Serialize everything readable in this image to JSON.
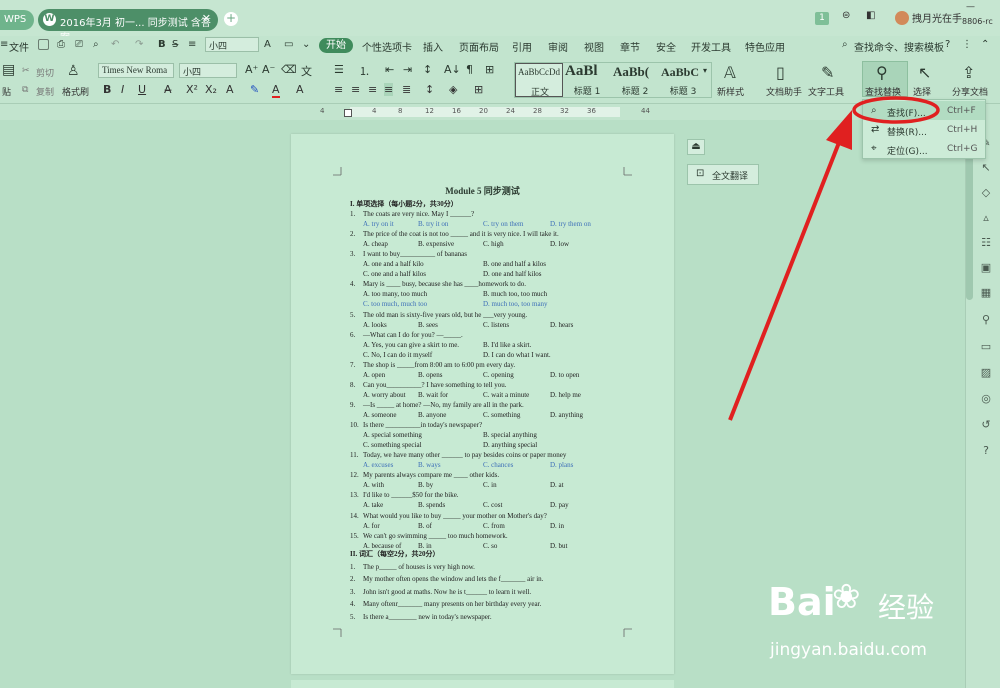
{
  "titlebar": {
    "app_tab": "WPS",
    "doc_tab": "2016年3月 初一...  同步测试 含答案",
    "page_count_badge": "1",
    "user_name": "拽月光在手",
    "user_id": "8806-rc"
  },
  "menubar": {
    "file": "文件",
    "font_size_quick": "小四",
    "items": [
      "开始",
      "个性选项卡",
      "插入",
      "页面布局",
      "引用",
      "审阅",
      "视图",
      "章节",
      "安全",
      "开发工具",
      "特色应用"
    ],
    "search": "查找命令、搜索模板"
  },
  "ribbon": {
    "paste": "贴",
    "cut": "剪切",
    "copy": "复制",
    "format_painter": "格式刷",
    "font_name": "Times New Roma",
    "font_size": "小四",
    "styles": [
      {
        "sample": "AaBbCcDd",
        "name": "正文"
      },
      {
        "sample": "AaBl",
        "name": "标题 1"
      },
      {
        "sample": "AaBb(",
        "name": "标题 2"
      },
      {
        "sample": "AaBbC",
        "name": "标题 3"
      }
    ],
    "new_style": "新样式",
    "doc_helper": "文档助手",
    "text_tools": "文字工具",
    "find_replace": "查找替换",
    "select": "选择",
    "share_doc": "分享文档"
  },
  "ruler": {
    "ticks": [
      "4",
      "4",
      "8",
      "12",
      "16",
      "20",
      "24",
      "28",
      "32",
      "36",
      "44"
    ]
  },
  "floating": {
    "full_translate": "全文翻译"
  },
  "dropdown": {
    "items": [
      {
        "label": "查找(F)...",
        "shortcut": "Ctrl+F"
      },
      {
        "label": "替换(R)...",
        "shortcut": "Ctrl+H"
      },
      {
        "label": "定位(G)...",
        "shortcut": "Ctrl+G"
      }
    ]
  },
  "document": {
    "title": "Module 5 同步测试",
    "section1": "I.  单项选择（每小题2分，共30分）",
    "section2": "II.  词汇（每空2分，共20分）",
    "lines": [
      {
        "n": "1.",
        "t": "The coats are very nice. May I ______?"
      },
      {
        "opts": [
          "A. try on it",
          "B. try it on",
          "C. try on them",
          "D. try them on"
        ],
        "blue": true
      },
      {
        "n": "2.",
        "t": "The price of the coat is not too _____ and it is very nice. I will take it."
      },
      {
        "opts": [
          "A. cheap",
          "B. expensive",
          "C. high",
          "D. low"
        ]
      },
      {
        "n": "3.",
        "t": "I want to buy__________ of bananas"
      },
      {
        "opts2": [
          "A. one and a half kilo",
          "B. one and half a kilos"
        ]
      },
      {
        "opts2": [
          "C. one and a half kilos",
          "D. one and half kilos"
        ]
      },
      {
        "n": "4.",
        "t": "Mary is ____ busy, because she has ____homework to do."
      },
      {
        "opts2": [
          "A. too many, too much",
          "B. much too, too much"
        ]
      },
      {
        "opts2": [
          "C. too much, much too",
          "D. much too, too many"
        ],
        "blue": true
      },
      {
        "n": "5.",
        "t": "The old man is sixty-five years old, but he ___very young."
      },
      {
        "opts": [
          "A. looks",
          "B. sees",
          "C. listens",
          "D. hears"
        ]
      },
      {
        "n": "6.",
        "t": "—What can I do for you? —_____."
      },
      {
        "opts2": [
          "A. Yes, you can give a skirt to me.",
          "B. I'd like a skirt."
        ]
      },
      {
        "opts2": [
          "C. No, I can do it myself",
          "D. I can do what I want."
        ]
      },
      {
        "n": "7.",
        "t": "The shop is _____from 8:00 am to 6:00 pm every day."
      },
      {
        "opts": [
          "A. open",
          "B. opens",
          "C. opening",
          "D. to open"
        ]
      },
      {
        "n": "8.",
        "t": "Can you__________? I have something to tell you."
      },
      {
        "opts": [
          "A. worry about",
          "B. wait for",
          "C. wait a minute",
          "D. help me"
        ]
      },
      {
        "n": "9.",
        "t": "—Is _____ at home?   —No, my family are all in the park."
      },
      {
        "opts": [
          "A. someone",
          "B. anyone",
          "C. something",
          "D. anything"
        ]
      },
      {
        "n": "10.",
        "t": "Is there __________in today's newspaper?"
      },
      {
        "opts2": [
          "A. special something",
          "B. special anything"
        ]
      },
      {
        "opts2": [
          "C. something special",
          "D. anything special"
        ]
      },
      {
        "n": "11.",
        "t": "Today, we have many other ______ to pay besides coins or paper money"
      },
      {
        "opts": [
          "A. excuses",
          "B. ways",
          "C. chances",
          "D. plans"
        ],
        "blue": true
      },
      {
        "n": "12.",
        "t": "My parents always compare me ____ other kids."
      },
      {
        "opts": [
          "A. with",
          "B. by",
          "C. in",
          "D. at"
        ]
      },
      {
        "n": "13.",
        "t": "I'd like to ______$50 for the bike."
      },
      {
        "opts": [
          "A. take",
          "B. spends",
          "C. cost",
          "D. pay"
        ]
      },
      {
        "n": "14.",
        "t": "What would you like to buy _____ your mother on Mother's day?"
      },
      {
        "opts": [
          "A. for",
          "B. of",
          "C. from",
          "D. in"
        ]
      },
      {
        "n": "15.",
        "t": "We can't go swimming _____ too much homework."
      },
      {
        "opts": [
          "A. because of",
          "B. in",
          "C. so",
          "D. but"
        ]
      }
    ],
    "vocab": [
      {
        "n": "1.",
        "t": "The p_____ of houses is very high now."
      },
      {
        "n": "2.",
        "t": "My mother often opens the window and lets the f_______ air in."
      },
      {
        "n": "3.",
        "t": "John isn't good at maths. Now he is t______ to learn it well."
      },
      {
        "n": "4.",
        "t": "Many oftenr_______ many presents on her birthday every year."
      },
      {
        "n": "5.",
        "t": "Is there a________ new in today's newspaper."
      }
    ]
  },
  "watermark": {
    "brand": "Bai",
    "cn": "经验",
    "url": "jingyan.baidu.com"
  },
  "colors": {
    "accent": "#3f8b5c",
    "annotation_red": "#e02020"
  }
}
